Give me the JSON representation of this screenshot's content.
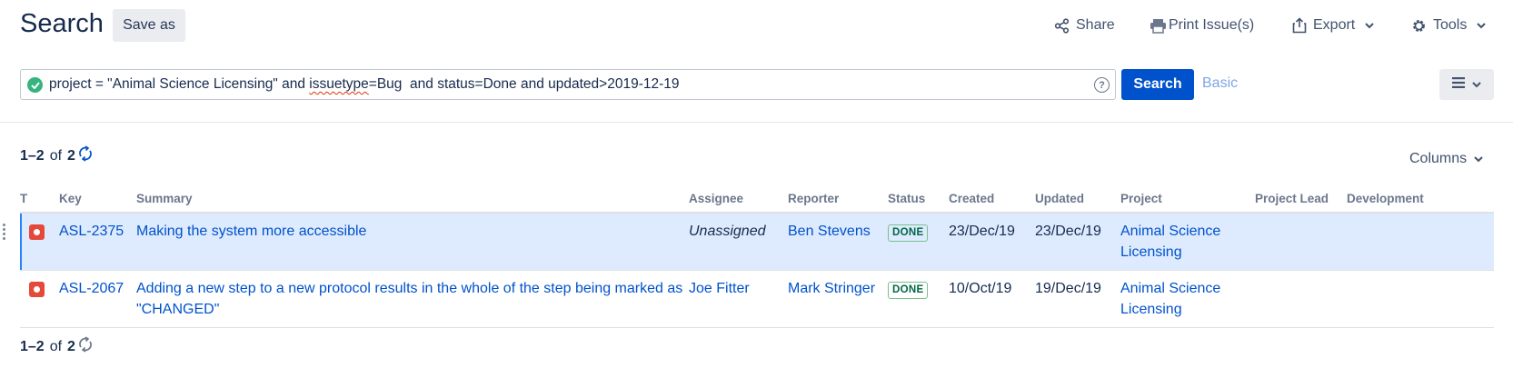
{
  "header": {
    "title": "Search",
    "save_as_label": "Save as",
    "share_label": "Share",
    "print_label": "Print Issue(s)",
    "export_label": "Export",
    "tools_label": "Tools"
  },
  "query": {
    "jql_part1": "project = \"Animal Science Licensing\" and ",
    "jql_spell": "issuetype",
    "jql_part2": "=Bug  and status=Done and updated>2019-12-19",
    "status_icon": "check-circle-icon",
    "help_symbol": "?",
    "search_label": "Search",
    "basic_label": "Basic"
  },
  "results": {
    "pager_top": {
      "range": "1–2",
      "of": "of",
      "total": "2"
    },
    "pager_bottom": {
      "range": "1–2",
      "of": "of",
      "total": "2"
    },
    "columns_label": "Columns",
    "headers": [
      "T",
      "Key",
      "Summary",
      "Assignee",
      "Reporter",
      "Status",
      "Created",
      "Updated",
      "Project",
      "Project Lead",
      "Development"
    ],
    "rows": [
      {
        "type_icon": "bug-icon",
        "key": "ASL-2375",
        "summary": "Making the system more accessible",
        "assignee": "Unassigned",
        "reporter": "Ben Stevens",
        "status": "DONE",
        "created": "23/Dec/19",
        "updated": "23/Dec/19",
        "project": "Animal Science Licensing",
        "project_lead": "",
        "development": "",
        "selected": true
      },
      {
        "type_icon": "bug-icon",
        "key": "ASL-2067",
        "summary": "Adding a new step to a new protocol results in the whole of the step being marked as \"CHANGED\"",
        "assignee": "Joe Fitter",
        "reporter": "Mark Stringer",
        "status": "DONE",
        "created": "10/Oct/19",
        "updated": "19/Dec/19",
        "project": "Animal Science Licensing",
        "project_lead": "",
        "development": "",
        "selected": false
      }
    ]
  },
  "colors": {
    "primary": "#0052cc",
    "selected_row": "#deebff",
    "bug": "#e5493a",
    "done": "#006644",
    "valid": "#36b37e"
  }
}
